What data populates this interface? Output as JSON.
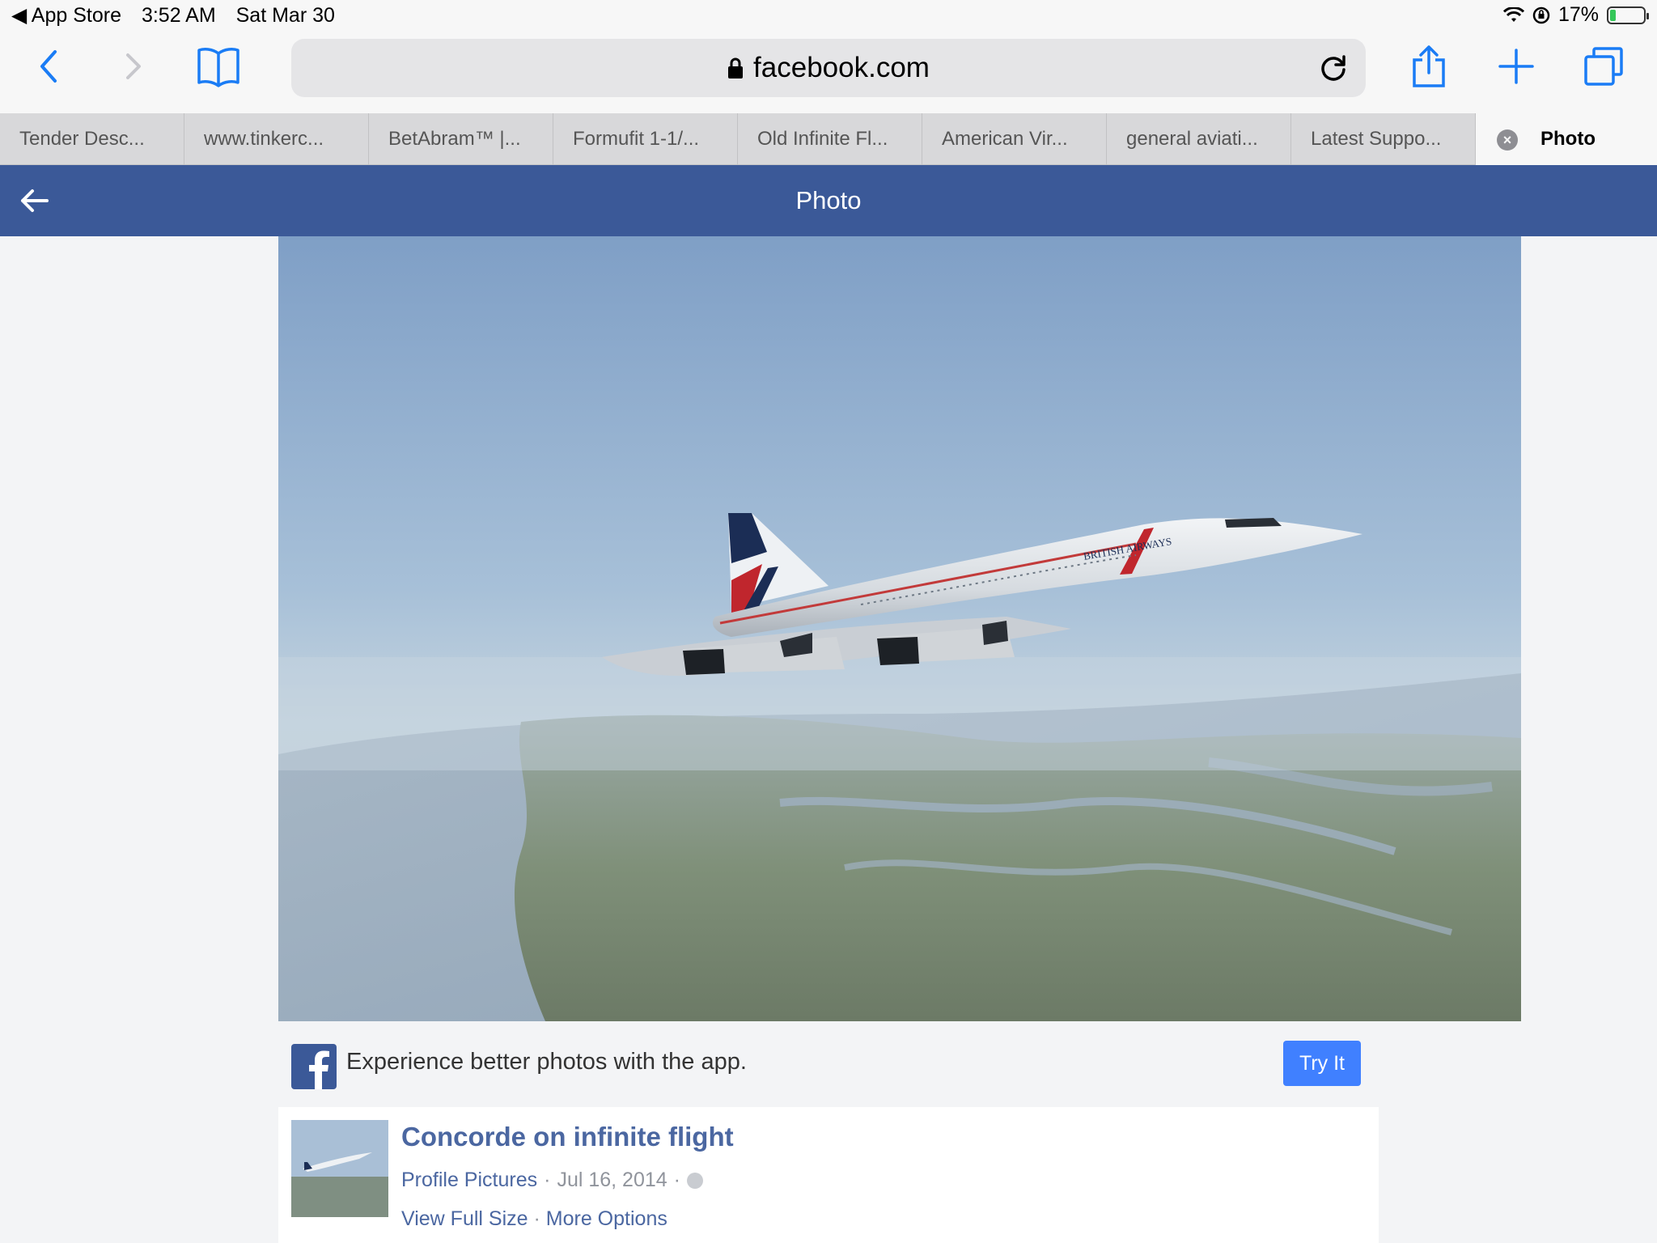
{
  "status_bar": {
    "back_app": "◀ App Store",
    "time": "3:52 AM",
    "date": "Sat Mar 30",
    "battery": "17%",
    "battery_level": 0.17
  },
  "safari": {
    "url": "facebook.com",
    "icons": {
      "back": "chevron-left-icon",
      "forward": "chevron-right-icon",
      "bookmarks": "book-icon",
      "lock": "lock-icon",
      "reload": "reload-icon",
      "share": "share-icon",
      "new_tab": "plus-icon",
      "tabs": "tabs-icon"
    },
    "accent_color": "#1a7cf5"
  },
  "tabs": [
    {
      "label": "Tender Desc..."
    },
    {
      "label": "www.tinkerc..."
    },
    {
      "label": "BetAbram™ |..."
    },
    {
      "label": "Formufit 1-1/..."
    },
    {
      "label": "Old Infinite Fl..."
    },
    {
      "label": "American Vir..."
    },
    {
      "label": "general aviati..."
    },
    {
      "label": "Latest Suppo..."
    }
  ],
  "active_tab": {
    "label": "Photo"
  },
  "fb_header": {
    "title": "Photo",
    "color": "#3b5998"
  },
  "app_banner": {
    "text": "Experience better photos with the app.",
    "button": "Try It"
  },
  "post": {
    "title": "Concorde on infinite flight",
    "album": "Profile Pictures",
    "sep": "·",
    "date": "Jul 16, 2014",
    "view_full": "View Full Size",
    "more_options": "More Options"
  }
}
